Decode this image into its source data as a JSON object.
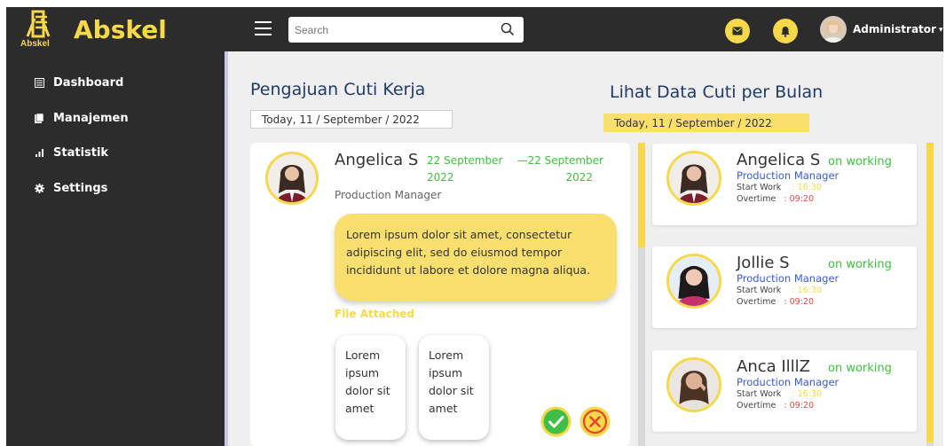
{
  "brand": {
    "name": "Abskel",
    "logo_text": "Abskel"
  },
  "topbar": {
    "search_placeholder": "Search",
    "user_name": "Administrator",
    "icons": [
      "menu-icon",
      "search-icon",
      "mail-icon",
      "bell-icon"
    ]
  },
  "sidebar": {
    "items": [
      {
        "label": "Dashboard",
        "icon": "dashboard-icon"
      },
      {
        "label": "Manajemen",
        "icon": "folder-icon"
      },
      {
        "label": "Statistik",
        "icon": "bar-chart-icon"
      },
      {
        "label": "Settings",
        "icon": "gear-icon"
      }
    ]
  },
  "leave_request": {
    "title": "Pengajuan Cuti Kerja",
    "date": "Today, 11 / September / 2022",
    "name": "Angelica S",
    "start_date_line1": "22 September",
    "start_date_line2": "2022",
    "end_date_line1": "—22 September",
    "end_date_line2": "2022",
    "role": "Production Manager",
    "message_line1": "Lorem ipsum dolor sit amet, consectetur",
    "message_line2": "adipiscing elit, sed do eiusmod tempor",
    "message_line3": "incididunt ut labore et dolore magna aliqua.",
    "file_label": "File Attached",
    "files": [
      {
        "line1": "Lorem",
        "line2": "ipsum",
        "line3": "dolor sit",
        "line4": "amet"
      },
      {
        "line1": "Lorem",
        "line2": "ipsum",
        "line3": "dolor sit",
        "line4": "amet"
      }
    ]
  },
  "monthly": {
    "title": "Lihat Data Cuti per Bulan",
    "date": "Today, 11 / September / 2022",
    "start_label": "Start Work",
    "overtime_label": "Overtime",
    "employees": [
      {
        "name": "Angelica S",
        "status": "on working",
        "role": "Production Manager",
        "start": ": 16:30",
        "overtime": ": 09:20"
      },
      {
        "name": "Jollie S",
        "status": "on working",
        "role": "Production Manager",
        "start": ": 16:30",
        "overtime": ": 09:20"
      },
      {
        "name": "Anca IlllZ",
        "status": "on working",
        "role": "Production Manager",
        "start": ": 16:30",
        "overtime": ": 09:20"
      }
    ]
  },
  "colors": {
    "accent": "#f6d94a",
    "sidebar": "#2c2c2c",
    "title": "#1f3a6b",
    "status": "#39c439",
    "role": "#3a5ad9",
    "approve": "#3fbf48",
    "reject": "#e8452c"
  }
}
